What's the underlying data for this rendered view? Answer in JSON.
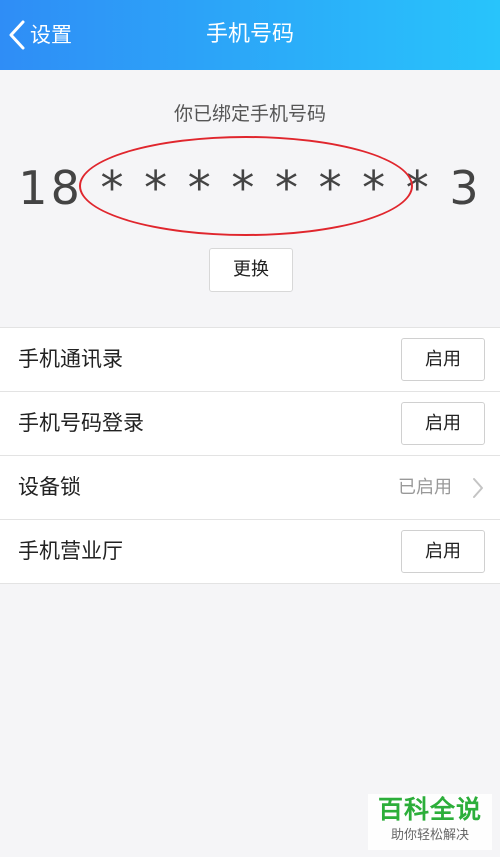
{
  "header": {
    "back_label": "设置",
    "title": "手机号码"
  },
  "binding": {
    "label": "你已绑定手机号码",
    "phone_number": "18 * * * * * * * * 3",
    "change_label": "更换"
  },
  "settings": {
    "items": [
      {
        "label": "手机通讯录",
        "action": "启用"
      },
      {
        "label": "手机号码登录",
        "action": "启用"
      },
      {
        "label": "设备锁",
        "status": "已启用"
      },
      {
        "label": "手机营业厅",
        "action": "启用"
      }
    ]
  },
  "watermark": {
    "main": "百科全说",
    "sub": "助你轻松解决"
  },
  "colors": {
    "header_start": "#2f8df6",
    "header_end": "#28c4fb",
    "annotation_red": "#e0262d",
    "watermark_green": "#2cae3a"
  }
}
